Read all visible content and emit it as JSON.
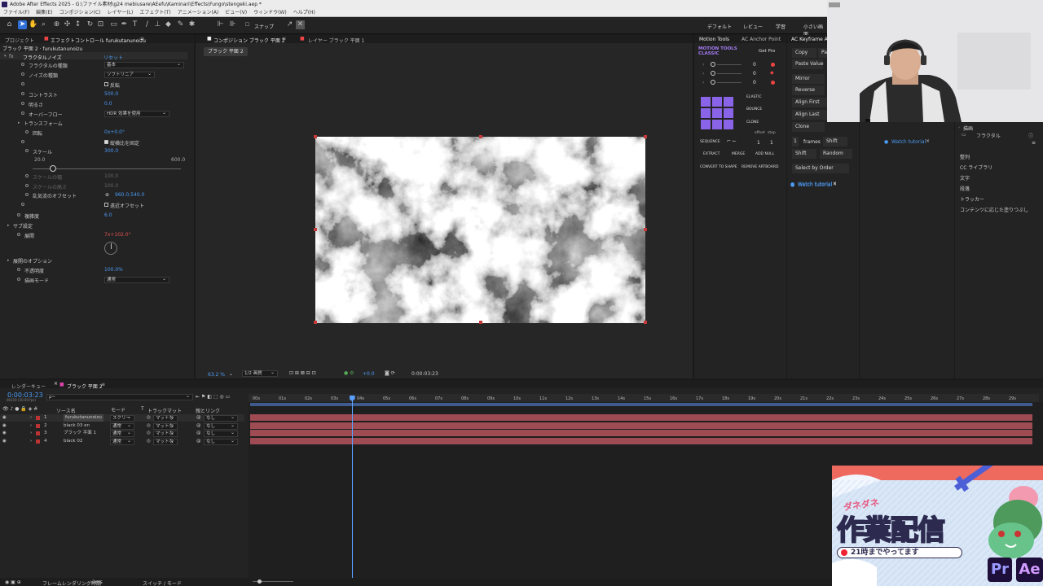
{
  "app": {
    "title": "Adobe After Effects 2025 - G:\\ファイル素材\\g24 mebiusare\\AEefu\\Kaminari\\Effects\\Fungo\\stengeki.aep *",
    "menu": [
      "ファイル(F)",
      "編集(E)",
      "コンポジション(C)",
      "レイヤー(L)",
      "エフェクト(T)",
      "アニメーション(A)",
      "ビュー(V)",
      "ウィンドウ(W)",
      "ヘルプ(H)"
    ],
    "snap_label": "スナップ",
    "workspaces": [
      "デフォルト",
      "レビュー",
      "学習",
      "小さい画面"
    ]
  },
  "effect_panel": {
    "tab_project": "プロジェクト",
    "tab_effects": "エフェクトコントロール furukutanunoizu",
    "layer_path": "ブラック 平面 2 · furukutanunoizu",
    "effect_name": "フラクタルノイズ",
    "reset": "リセット",
    "rows": [
      {
        "label": "フラクタルの種類",
        "value": "基本",
        "kind": "dropdown"
      },
      {
        "label": "ノイズの種類",
        "value": "ソフトリニア",
        "kind": "dropdown"
      },
      {
        "label": "",
        "value": "反転",
        "kind": "checkbox"
      },
      {
        "label": "コントラスト",
        "value": "500.0",
        "kind": "value"
      },
      {
        "label": "明るさ",
        "value": "0.0",
        "kind": "value"
      },
      {
        "label": "オーバーフロー",
        "value": "HDR 効果を使用",
        "kind": "dropdown"
      },
      {
        "label": "トランスフォーム",
        "value": "",
        "kind": "group"
      },
      {
        "label": "回転",
        "value": "0x+0.0°",
        "kind": "value"
      },
      {
        "label": "",
        "value": "縦横比を固定",
        "kind": "checkbox"
      },
      {
        "label": "スケール",
        "value": "300.0",
        "kind": "value"
      },
      {
        "label": "",
        "value": "",
        "kind": "slider"
      },
      {
        "label": "スケールの幅",
        "value": "100.0",
        "kind": "dim"
      },
      {
        "label": "スケールの高さ",
        "value": "100.0",
        "kind": "dim"
      },
      {
        "label": "乱気流のオフセット",
        "value": "960.0,540.0",
        "kind": "value"
      },
      {
        "label": "",
        "value": "遠近オフセット",
        "kind": "checkbox"
      },
      {
        "label": "複雑度",
        "value": "6.0",
        "kind": "value"
      },
      {
        "label": "サブ設定",
        "value": "",
        "kind": "group"
      },
      {
        "label": "展開",
        "value": "7x+102.0°",
        "kind": "red"
      },
      {
        "label": "",
        "value": "",
        "kind": "dial"
      },
      {
        "label": "展開のオプション",
        "value": "",
        "kind": "group"
      },
      {
        "label": "不透明度",
        "value": "100.0%",
        "kind": "value"
      },
      {
        "label": "描画モード",
        "value": "通常",
        "kind": "dropdown"
      }
    ],
    "slider_min": "20.0",
    "slider_max": "600.0",
    "slider_fraction": 0.14
  },
  "comp_panel": {
    "tab_comp": "コンポジション ブラック 平面 2",
    "tab_layer": "レイヤー ブラック 平面 1",
    "breadcrumb": "ブラック 平面 2",
    "zoom": "63.2 %",
    "resolution": "1/2 画質",
    "exposure": "+0.0",
    "timecode": "0:00:03:23"
  },
  "motion_tools": {
    "tab": "Motion Tools",
    "tab2": "AC Anchor Point",
    "brand": "MOTION TOOLS CLASSIC",
    "get_pro": "Get Pro",
    "values": [
      "0",
      "0",
      "0"
    ],
    "elastic": "ELASTIC",
    "bounce": "BOUNCE",
    "clone": "CLONE",
    "offset": "offset",
    "step": "step",
    "sequence": "SEQUENCE",
    "one": "1",
    "buttons": [
      "EXTRACT",
      "MERGE",
      "ADD NULL",
      "CONVERT TO SHAPE",
      "REMOVE ARTBOARD"
    ],
    "watch": "Watch tutorial"
  },
  "keyframe_panel": {
    "tab": "AC Keyframe Act",
    "copy": "Copy",
    "paste_short": "Pas",
    "paste_value": "Paste Value",
    "items": [
      "Mirror",
      "Reverse",
      "Align First",
      "Align Last",
      "Clone"
    ],
    "frames_num": "1",
    "frames": "frames",
    "shift": "Shift",
    "shift2": "Shift",
    "random": "Random",
    "select_by_order": "Select by Order",
    "watch": "Watch tutorial"
  },
  "watch_tutorial_3": "Watch tutorial",
  "right_panel": {
    "header": "描画",
    "fractal": "フラクタル",
    "items": [
      "整列",
      "CC ライブラリ",
      "文字",
      "段落",
      "トラッカー",
      "コンテンツに応じた塗りつぶし"
    ]
  },
  "timeline": {
    "tab_render": "レンダーキュー",
    "tab_comp": "ブラック 平面 2",
    "timecode": "0:00:03:23",
    "fps": "00119 (30.00 fps)",
    "search_placeholder": "ρ~",
    "col_source": "ソース名",
    "col_mode": "モード",
    "col_t": "T",
    "col_matte": "トラックマット",
    "col_parent": "親とリンク",
    "layers": [
      {
        "num": "1",
        "name": "furukutanunoizu",
        "mode": "スクリー",
        "matte": "マットな",
        "parent": "なし"
      },
      {
        "num": "2",
        "name": "black 03 en",
        "mode": "通常",
        "matte": "マットな",
        "parent": "なし"
      },
      {
        "num": "3",
        "name": "ブラック 平面 1",
        "mode": "通常",
        "matte": "マットな",
        "parent": "なし"
      },
      {
        "num": "4",
        "name": "black 02",
        "mode": "通常",
        "matte": "マットな",
        "parent": "なし"
      }
    ],
    "ruler": [
      "00s",
      "01s",
      "02s",
      "03s",
      "04s",
      "05s",
      "06s",
      "07s",
      "08s",
      "09s",
      "10s",
      "11s",
      "12s",
      "13s",
      "14s",
      "15s",
      "16s",
      "17s",
      "18s",
      "19s",
      "20s",
      "21s",
      "22s",
      "23s",
      "24s",
      "25s",
      "26s",
      "27s",
      "28s",
      "29s"
    ],
    "playhead_seconds": 3.8,
    "duration_seconds": 30,
    "footer_render": "フレームレンダリング時間",
    "footer_render_value": "2ms",
    "footer_mode": "スイッチ / モード"
  },
  "overlay": {
    "kana": "ダネダネ",
    "main": "作業配信",
    "sub": "21時までやってます",
    "pr": "Pr",
    "ae": "Ae"
  }
}
